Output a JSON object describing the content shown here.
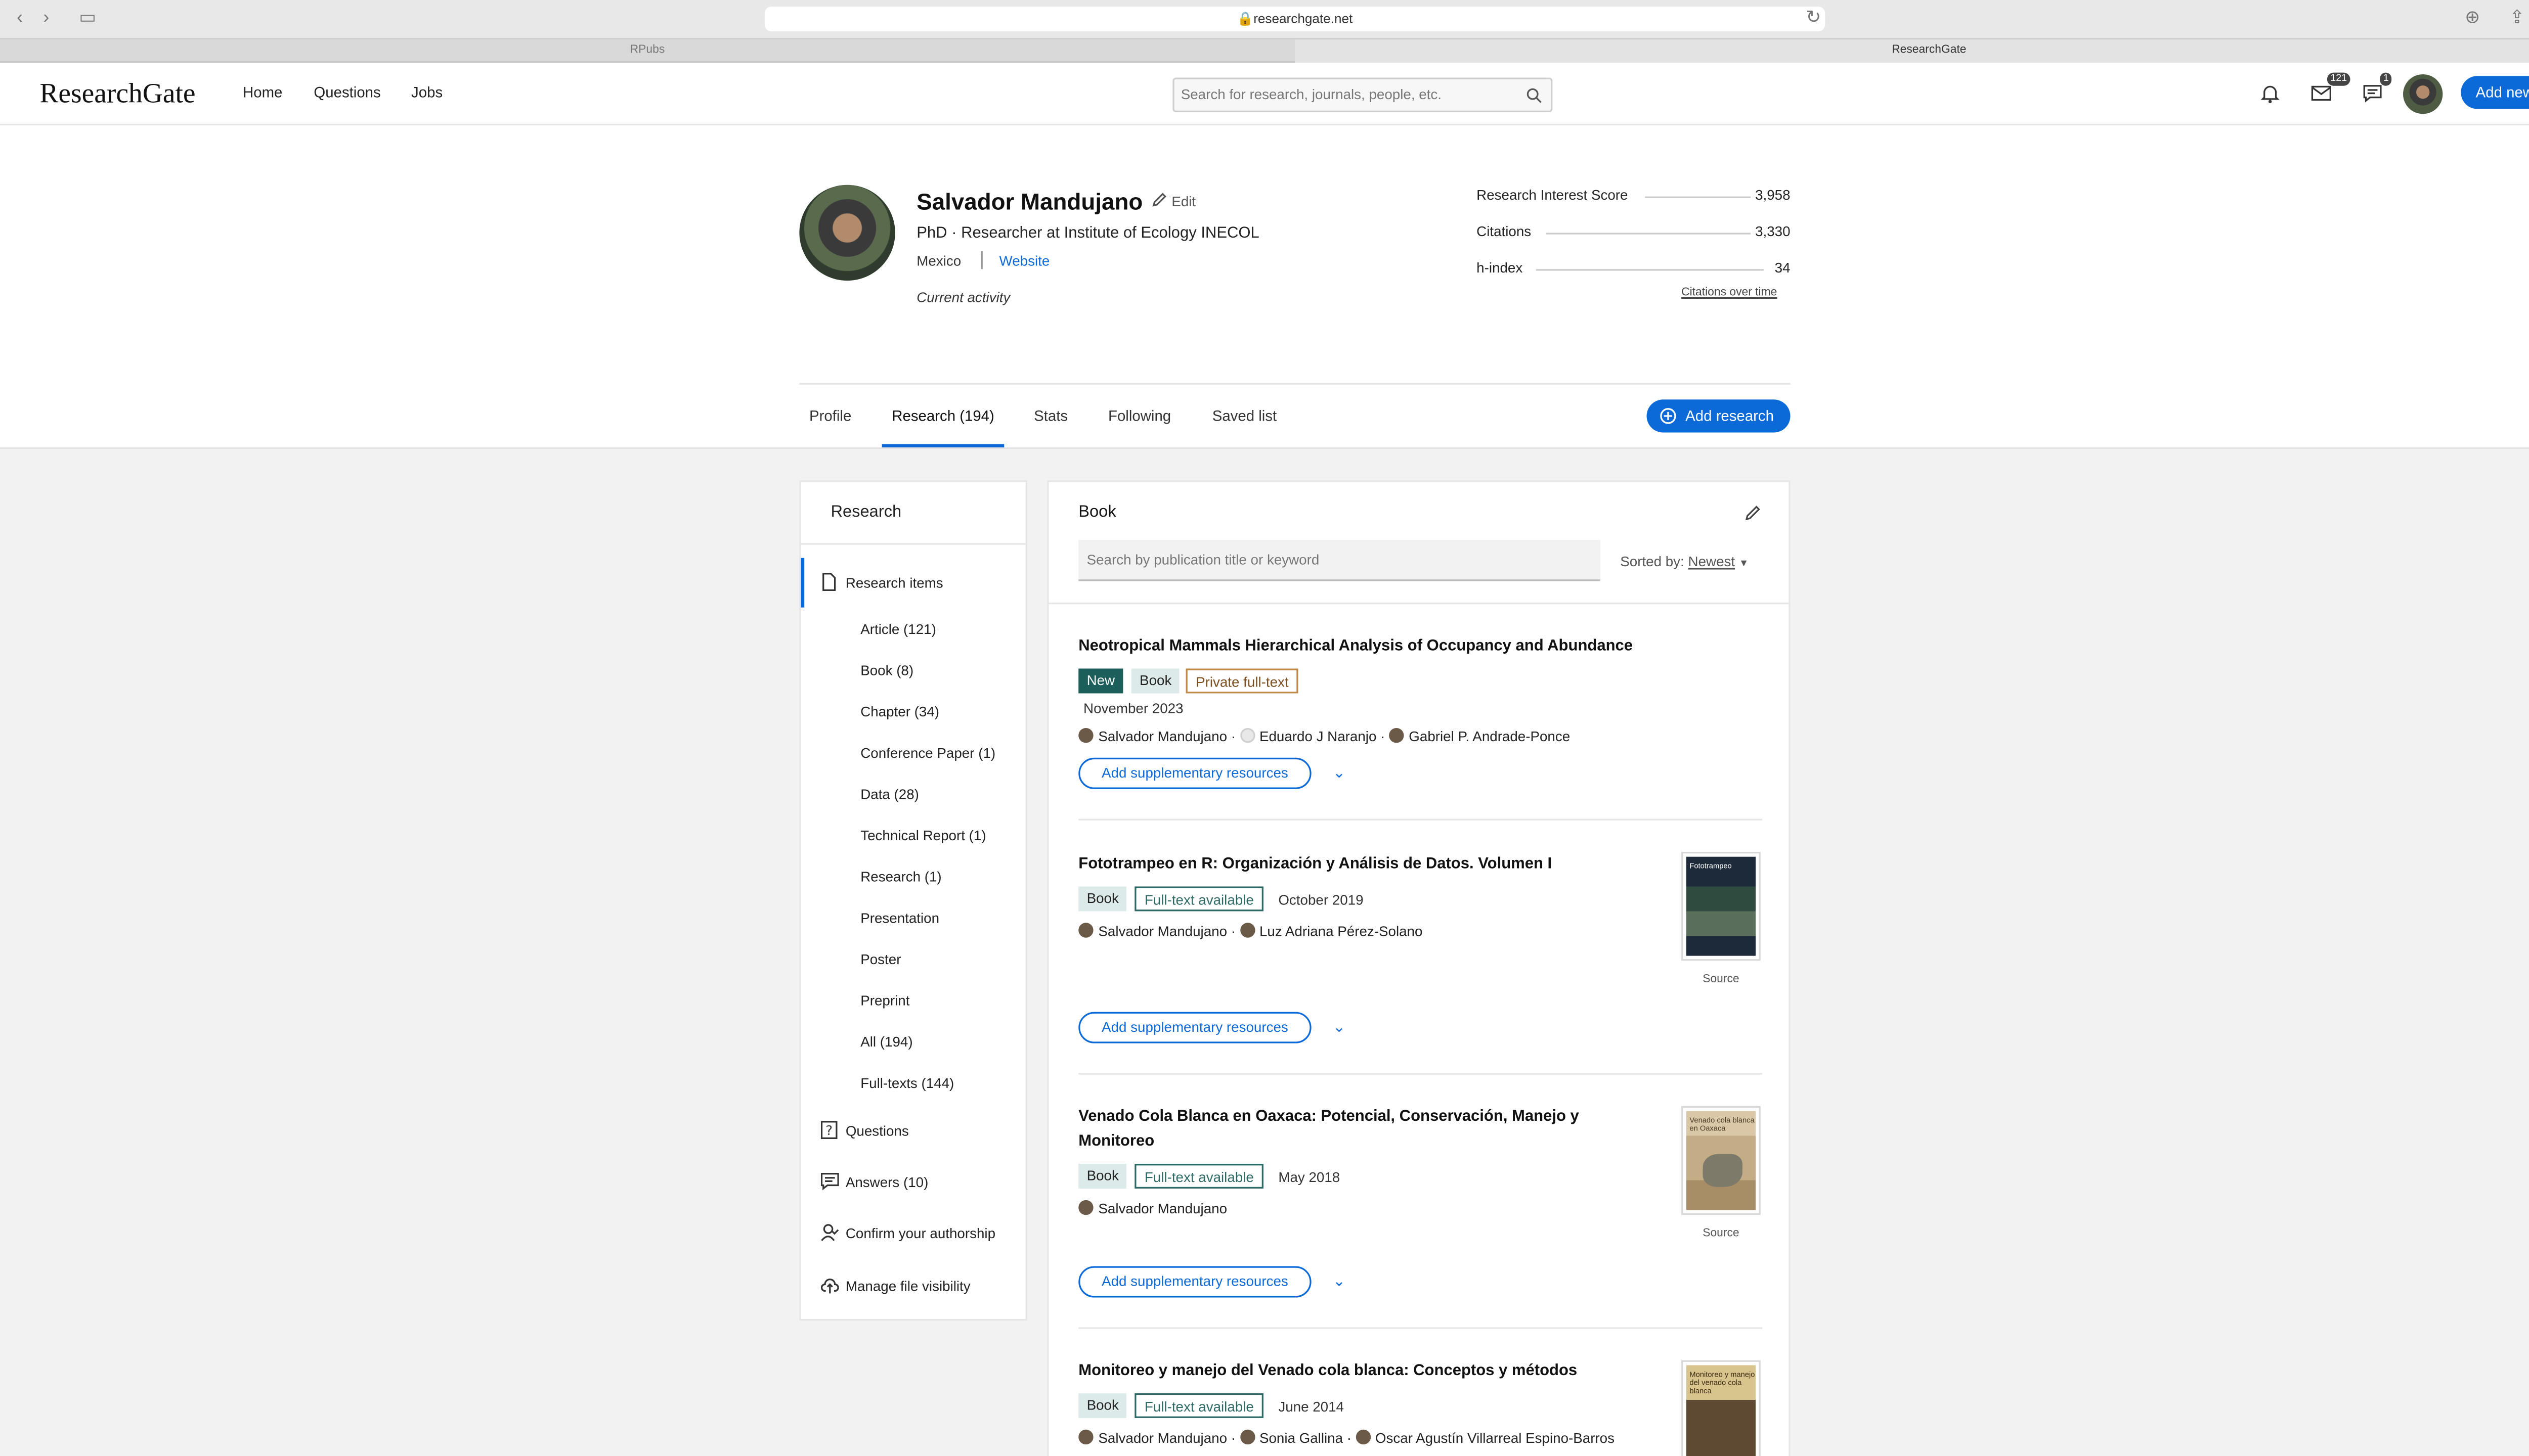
{
  "browser": {
    "url": "researchgate.net",
    "tabs": [
      "RPubs",
      "ResearchGate"
    ]
  },
  "header": {
    "logo": "ResearchGate",
    "nav": [
      "Home",
      "Questions",
      "Jobs"
    ],
    "search_placeholder": "Search for research, journals, people, etc.",
    "messages_count": "121",
    "chat_count": "1",
    "add_new": "Add new"
  },
  "profile": {
    "name": "Salvador Mandujano",
    "edit": "Edit",
    "position": "PhD · Researcher at Institute of Ecology INECOL",
    "location": "Mexico",
    "website": "Website",
    "activity": "Current activity",
    "stats": [
      {
        "label": "Research Interest Score",
        "value": "3,958"
      },
      {
        "label": "Citations",
        "value": "3,330"
      },
      {
        "label": "h-index",
        "value": "34"
      }
    ],
    "citations_link": "Citations over time",
    "tabs": [
      "Profile",
      "Research (194)",
      "Stats",
      "Following",
      "Saved list"
    ],
    "add_research": "Add research"
  },
  "sidebar": {
    "title": "Research",
    "research_items": "Research items",
    "sub_items": [
      "Article (121)",
      "Book (8)",
      "Chapter (34)",
      "Conference Paper (1)",
      "Data (28)",
      "Technical Report (1)",
      "Research (1)",
      "Presentation",
      "Poster",
      "Preprint",
      "All (194)",
      "Full-texts (144)"
    ],
    "questions": "Questions",
    "answers": "Answers (10)",
    "confirm": "Confirm your authorship",
    "manage": "Manage file visibility"
  },
  "main": {
    "heading": "Book",
    "search_placeholder": "Search by publication title or keyword",
    "sorted_label": "Sorted by:",
    "sorted_value": "Newest",
    "supp_label": "Add supplementary resources",
    "source_label": "Source",
    "items": [
      {
        "title": "Neotropical Mammals Hierarchical Analysis of Occupancy and Abundance",
        "tags": [
          "New",
          "Book",
          "Private full-text"
        ],
        "date": "November 2023",
        "authors": [
          "Salvador Mandujano",
          "Eduardo J Naranjo",
          "Gabriel P. Andrade-Ponce"
        ]
      },
      {
        "title": "Fototrampeo en R: Organización y Análisis de Datos. Volumen I",
        "tags": [
          "Book",
          "Full-text available"
        ],
        "date": "October 2019",
        "authors": [
          "Salvador Mandujano",
          "Luz Adriana Pérez-Solano"
        ],
        "thumb": "Fototrampeo"
      },
      {
        "title": "Venado Cola Blanca en Oaxaca: Potencial, Conservación, Manejo y",
        "title2": "Monitoreo",
        "tags": [
          "Book",
          "Full-text available"
        ],
        "date": "May 2018",
        "authors": [
          "Salvador Mandujano"
        ],
        "thumb": "Venado cola blanca en Oaxaca"
      },
      {
        "title": "Monitoreo y manejo del Venado cola blanca: Conceptos y métodos",
        "tags": [
          "Book",
          "Full-text available"
        ],
        "date": "June 2014",
        "authors": [
          "Salvador Mandujano",
          "Sonia Gallina",
          "Oscar Agustín Villarreal Espino-Barros"
        ],
        "thumb": "Monitoreo y manejo del venado cola blanca"
      }
    ]
  }
}
